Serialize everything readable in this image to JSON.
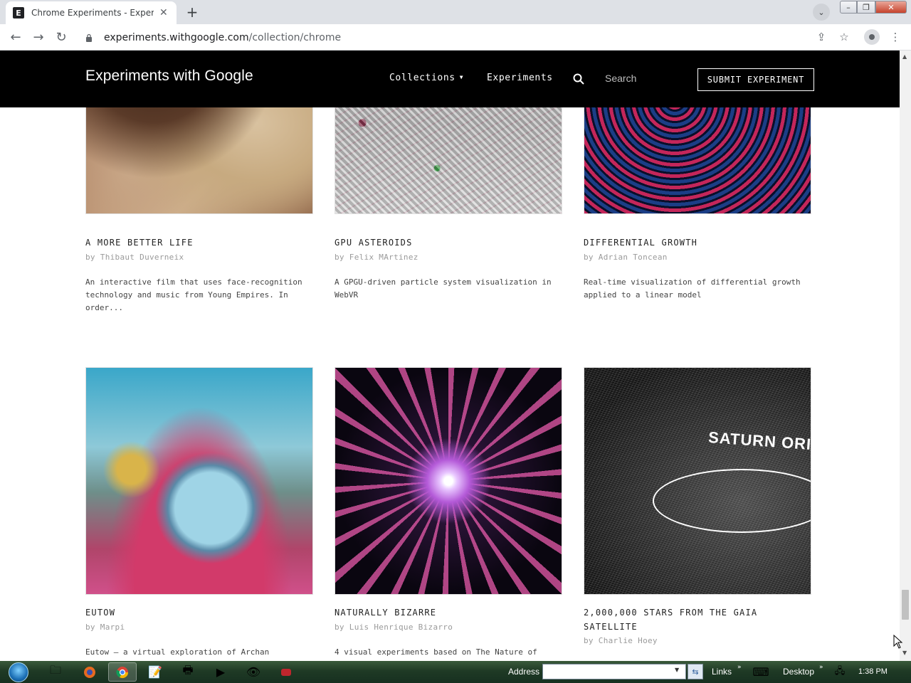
{
  "browser": {
    "tab_title": "Chrome Experiments - Experimen",
    "tab_favicon": "E",
    "url_host": "experiments.withgoogle.com",
    "url_path": "/collection/chrome"
  },
  "site": {
    "logo": "Experiments with Google",
    "nav": {
      "collections": "Collections",
      "experiments": "Experiments",
      "search_label": "Search"
    },
    "submit_label": "SUBMIT EXPERIMENT"
  },
  "cards": [
    {
      "title": "A MORE BETTER LIFE",
      "author": "by Thibaut Duverneix",
      "description": "An interactive film that uses face-recognition technology and music from Young Empires. In order..."
    },
    {
      "title": "GPU ASTEROIDS",
      "author": "by Felix MArtinez",
      "description": "A GPGU-driven particle system visualization in WebVR"
    },
    {
      "title": "DIFFERENTIAL GROWTH",
      "author": "by Adrian Toncean",
      "description": "Real-time visualization of differential growth applied to a linear model"
    },
    {
      "title": "EUTOW",
      "author": "by Marpi",
      "description": "Eutow – a virtual exploration of Archan"
    },
    {
      "title": "NATURALLY BIZARRE",
      "author": "by Luis Henrique Bizarro",
      "description": "4 visual experiments based on The Nature of"
    },
    {
      "title": "2,000,000 STARS FROM THE GAIA SATELLITE",
      "author": "by Charlie Hoey",
      "description": "",
      "thumb_text": "SATURN ORI"
    }
  ],
  "taskbar": {
    "address_label": "Address",
    "links_label": "Links",
    "desktop_label": "Desktop",
    "clock": "1:38 PM"
  }
}
